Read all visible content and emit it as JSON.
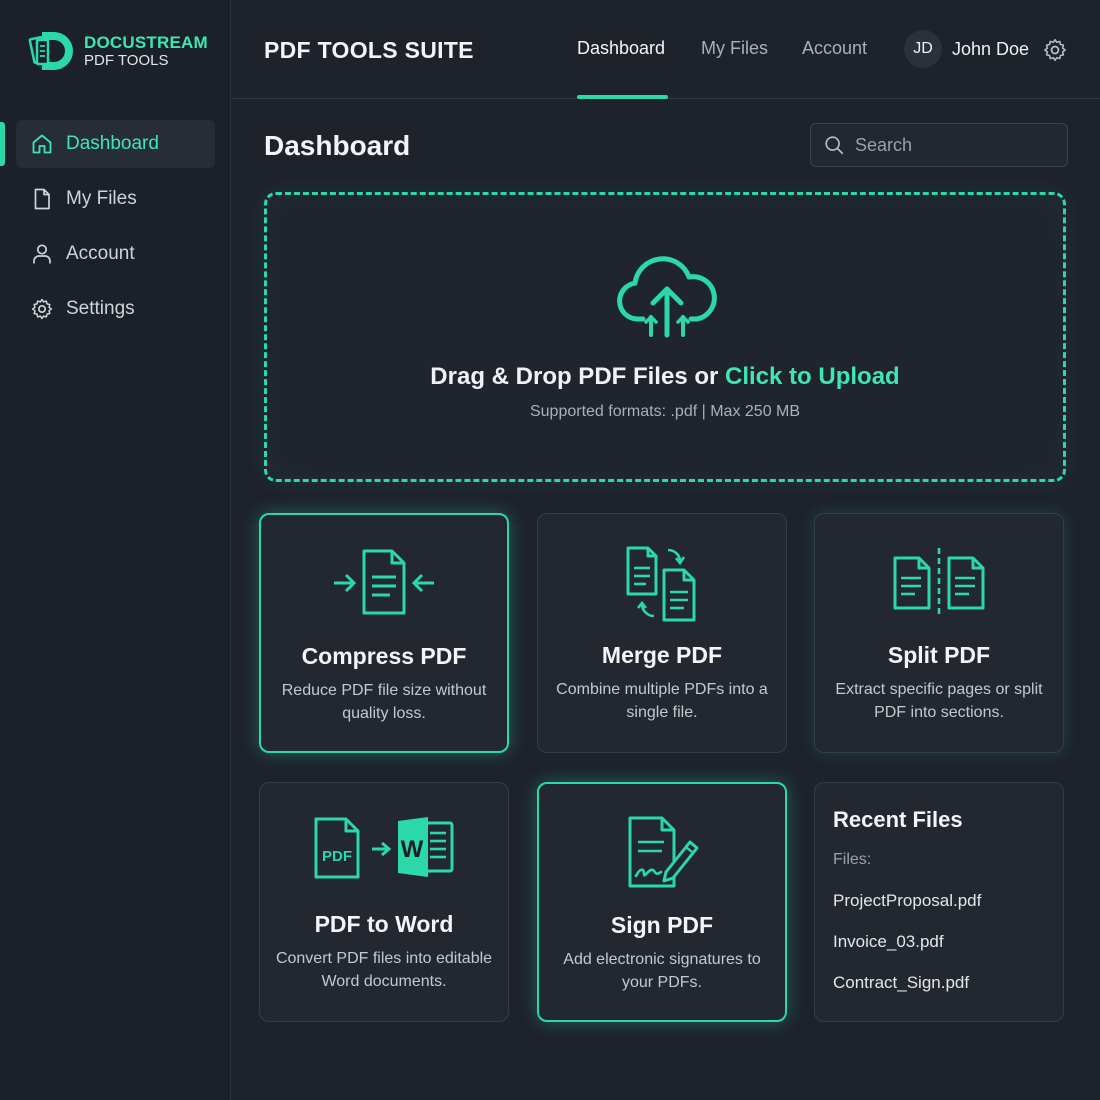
{
  "colors": {
    "accent": "#2ad9a7",
    "background": "#1e222b",
    "card": "#232830"
  },
  "logo": {
    "brand": "DOCUSTREAM",
    "sub": "PDF TOOLS",
    "icon": "docustream-logo-icon"
  },
  "sidebar": {
    "items": [
      {
        "label": "Dashboard",
        "icon": "home-icon",
        "active": true
      },
      {
        "label": "My Files",
        "icon": "file-icon"
      },
      {
        "label": "Account",
        "icon": "user-icon"
      },
      {
        "label": "Settings",
        "icon": "gear-icon"
      }
    ]
  },
  "header": {
    "title": "PDF TOOLS SUITE",
    "tabs": [
      {
        "label": "Dashboard",
        "active": true
      },
      {
        "label": "My Files"
      },
      {
        "label": "Account"
      }
    ],
    "user": {
      "initials": "JD",
      "name": "John Doe"
    }
  },
  "main": {
    "title": "Dashboard",
    "search": {
      "placeholder": "Search",
      "value": ""
    },
    "upload": {
      "title_prefix": "Drag & Drop PDF Files or",
      "title_link": "Click to Upload",
      "subtitle": "Supported formats: .pdf | Max 250 MB"
    },
    "tools": [
      {
        "title": "Compress PDF",
        "description": "Reduce PDF file size without quality loss.",
        "icon": "compress-icon"
      },
      {
        "title": "Merge PDF",
        "description": "Combine multiple PDFs into a single file.",
        "icon": "merge-icon"
      },
      {
        "title": "Split PDF",
        "description": "Extract specific pages or split PDF into sections.",
        "icon": "split-icon"
      },
      {
        "title": "PDF to Word",
        "description": "Convert PDF files into editable Word documents.",
        "icon": "pdf-to-word-icon",
        "icon_text_pdf": "PDF",
        "icon_text_word": "W"
      },
      {
        "title": "Sign PDF",
        "description": "Add electronic signatures to your PDFs.",
        "icon": "signature-icon"
      }
    ],
    "recent": {
      "title": "Recent Files",
      "label": "Files:",
      "files": [
        "ProjectProposal.pdf",
        "Invoice_03.pdf",
        "Contract_Sign.pdf"
      ]
    }
  }
}
